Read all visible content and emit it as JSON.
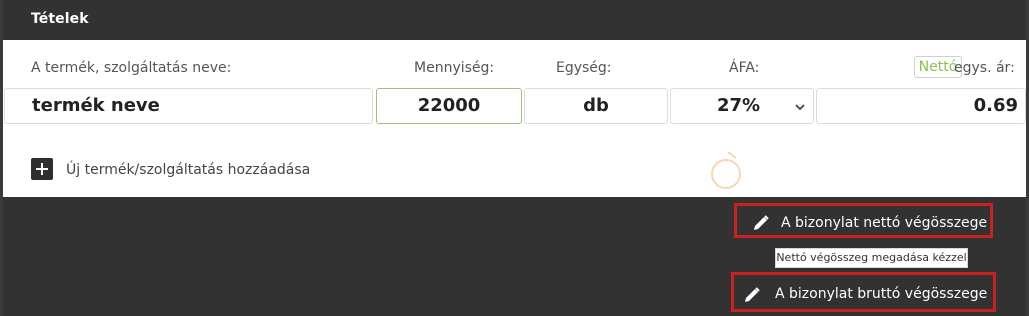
{
  "section": {
    "title": "Tételek"
  },
  "columns": {
    "name_label": "A termék, szolgáltatás neve:",
    "quantity_label": "Mennyiség:",
    "unit_label": "Egység:",
    "vat_label": "ÁFA:",
    "price_type_badge": "Nettó",
    "unit_price_label": "egys. ár:"
  },
  "item": {
    "name": "termék neve",
    "quantity": "22000",
    "unit": "db",
    "vat": "27%",
    "unit_price": "0.69"
  },
  "add_item": {
    "label": "Új termék/szolgáltatás hozzáadása"
  },
  "totals": {
    "net_total_label": "A bizonylat nettó végösszege",
    "tooltip": "Nettó végösszeg megadása kézzel",
    "gross_total_label": "A bizonylat bruttó végösszege"
  },
  "colors": {
    "header_bg": "#333232",
    "accent_green": "#8bc34a",
    "highlight_red": "#c8211f"
  }
}
